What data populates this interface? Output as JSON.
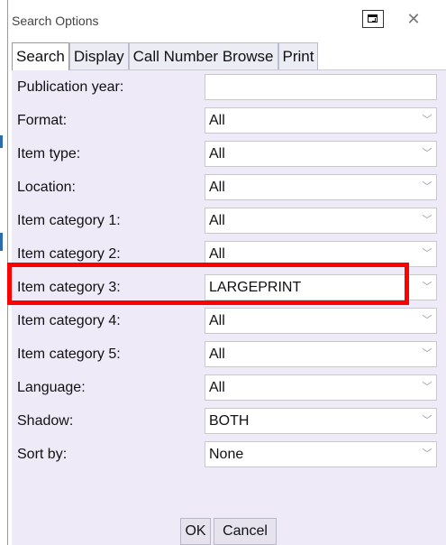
{
  "window": {
    "title": "Search Options",
    "close_glyph": "✕"
  },
  "tabs": [
    {
      "label": "Search",
      "active": true
    },
    {
      "label": "Display",
      "active": false
    },
    {
      "label": "Call Number Browse",
      "active": false
    },
    {
      "label": "Print",
      "active": false
    }
  ],
  "fields": [
    {
      "label": "Publication year:",
      "value": "",
      "type": "text"
    },
    {
      "label": "Format:",
      "value": "All",
      "type": "select"
    },
    {
      "label": "Item type:",
      "value": "All",
      "type": "select"
    },
    {
      "label": "Location:",
      "value": "All",
      "type": "select"
    },
    {
      "label": "Item category 1:",
      "value": "All",
      "type": "select"
    },
    {
      "label": "Item category 2:",
      "value": "All",
      "type": "select"
    },
    {
      "label": "Item category 3:",
      "value": "LARGEPRINT",
      "type": "select"
    },
    {
      "label": "Item category 4:",
      "value": "All",
      "type": "select"
    },
    {
      "label": "Item category 5:",
      "value": "All",
      "type": "select"
    },
    {
      "label": "Language:",
      "value": "All",
      "type": "select"
    },
    {
      "label": "Shadow:",
      "value": "BOTH",
      "type": "select"
    },
    {
      "label": "Sort by:",
      "value": "None",
      "type": "select"
    }
  ],
  "buttons": {
    "ok": "OK",
    "cancel": "Cancel"
  },
  "dropdown_arrow_glyph": "﹀",
  "highlight_color": "#ff0000"
}
